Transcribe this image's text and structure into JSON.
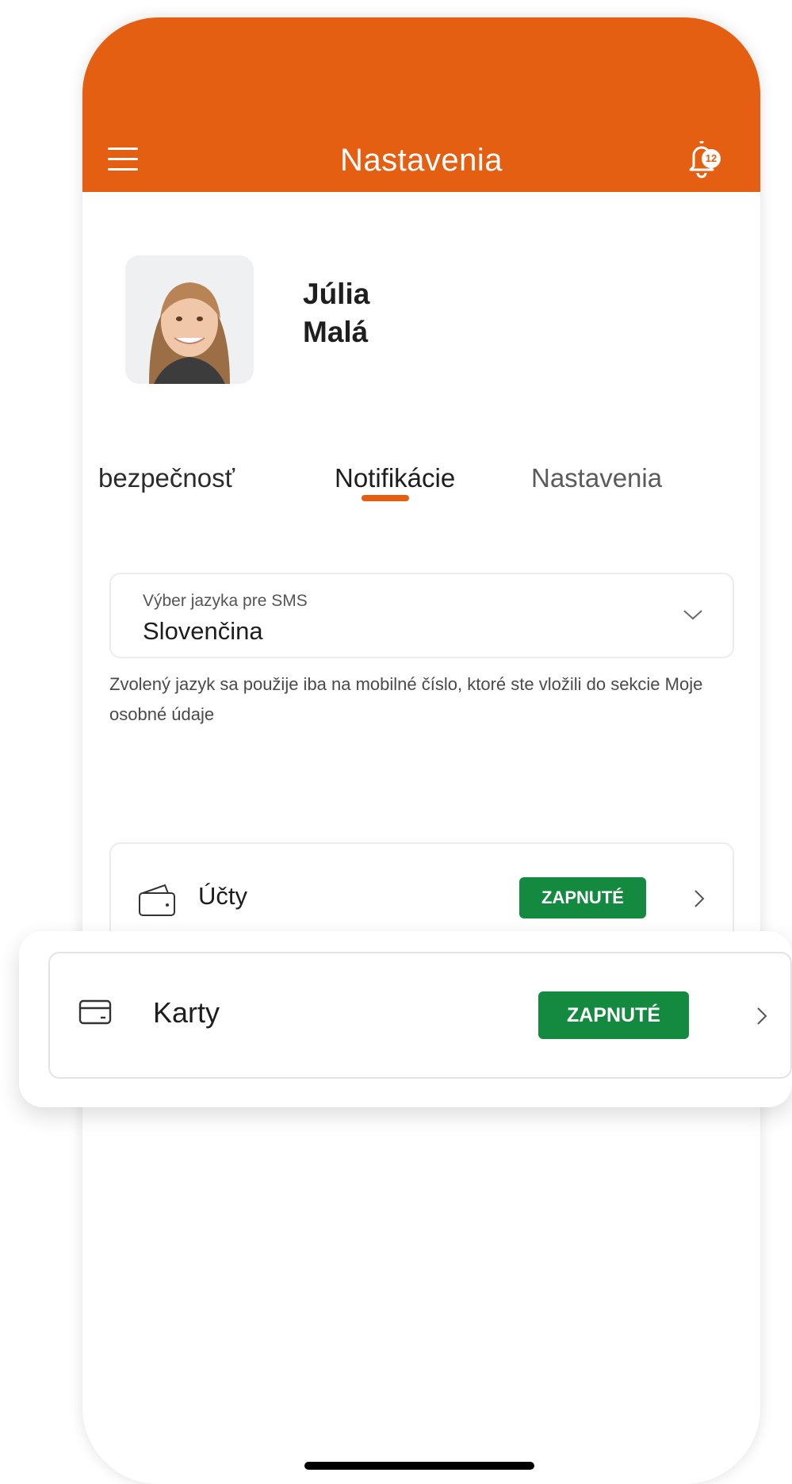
{
  "header": {
    "title": "Nastavenia",
    "notification_count": "12",
    "menu_icon": "hamburger-menu-icon",
    "bell_icon": "bell-icon"
  },
  "profile": {
    "first_name": "Júlia",
    "last_name": "Malá"
  },
  "tabs": [
    {
      "label": "bezpečnosť",
      "active": false
    },
    {
      "label": "Notifikácie",
      "active": true
    },
    {
      "label": "Nastavenia",
      "active": false
    }
  ],
  "sms_language": {
    "label": "Výber jazyka pre SMS",
    "value": "Slovenčina",
    "hint": "Zvolený jazyk sa použije iba na mobilné číslo, ktoré ste vložili do sekcie Moje osobné údaje"
  },
  "rows": {
    "accounts": {
      "label": "Účty",
      "badge": "ZAPNUTÉ"
    },
    "cards": {
      "label": "Karty",
      "badge": "ZAPNUTÉ"
    }
  },
  "colors": {
    "brand": "#e55f12",
    "badge_green": "#138a3f"
  }
}
